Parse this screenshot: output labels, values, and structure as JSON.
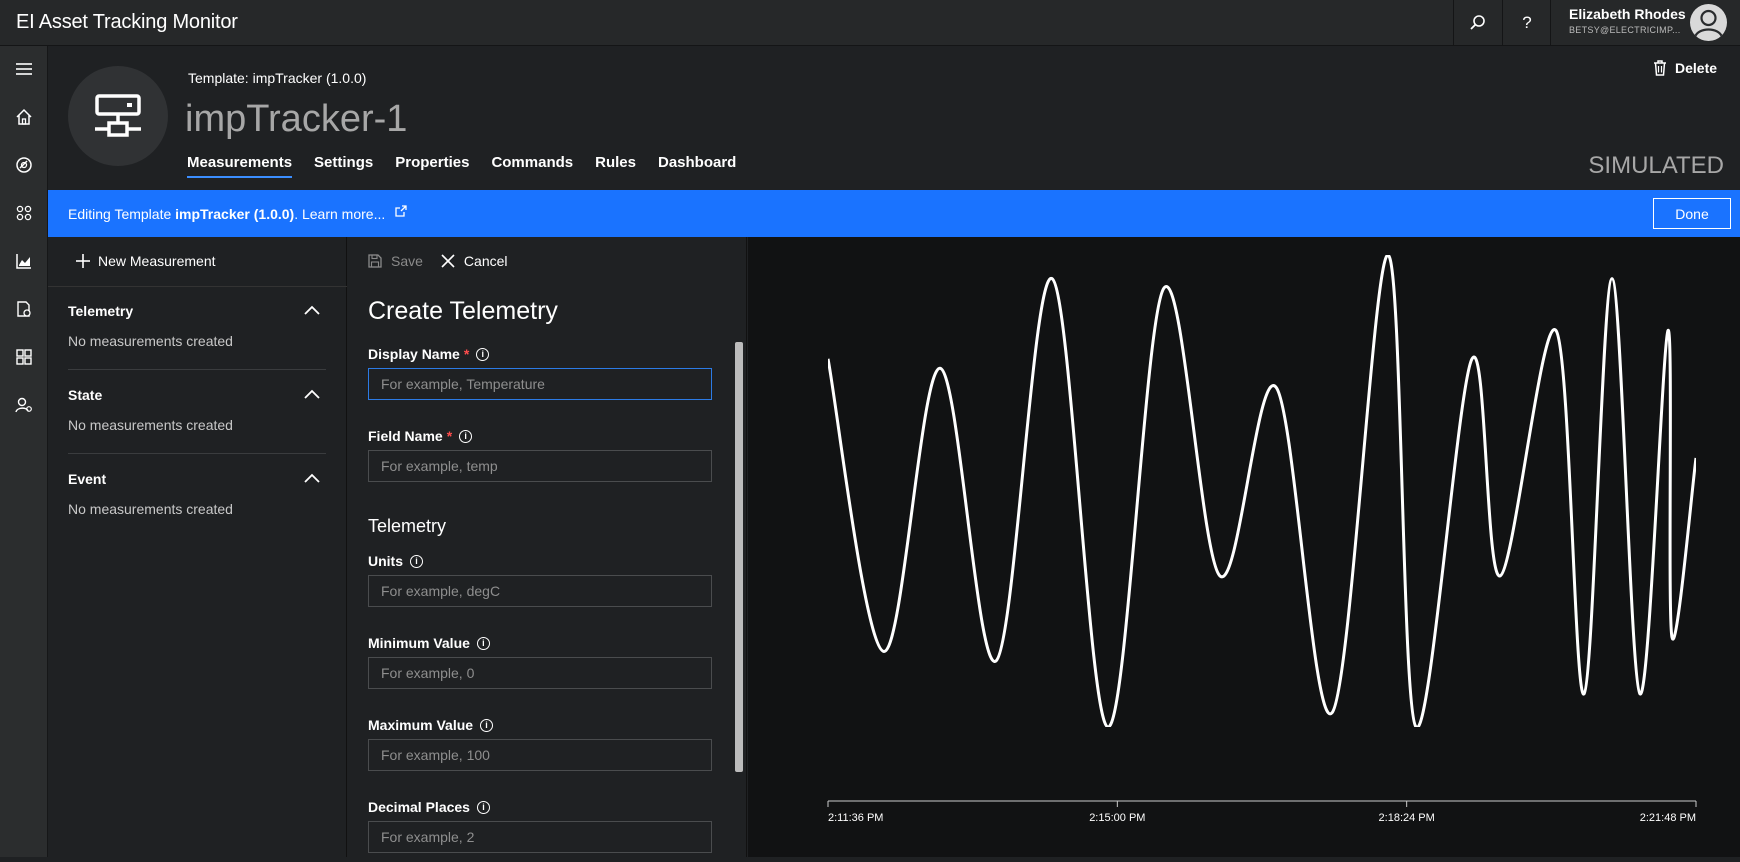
{
  "app": {
    "title": "EI Asset Tracking Monitor"
  },
  "user": {
    "name": "Elizabeth Rhodes",
    "email": "BETSY@ELECTRICIMP..."
  },
  "header": {
    "template_label": "Template:  impTracker  (1.0.0)",
    "device_name": "impTracker-1",
    "delete_label": "Delete",
    "simulated_label": "SIMULATED",
    "tabs": [
      {
        "label": "Measurements",
        "active": true
      },
      {
        "label": "Settings"
      },
      {
        "label": "Properties"
      },
      {
        "label": "Commands"
      },
      {
        "label": "Rules"
      },
      {
        "label": "Dashboard"
      }
    ]
  },
  "banner": {
    "prefix": "Editing Template ",
    "template": "impTracker (1.0.0)",
    "suffix": ". Learn more...",
    "done_label": "Done"
  },
  "measurements": {
    "new_label": "New Measurement",
    "sections": [
      {
        "title": "Telemetry",
        "empty_text": "No measurements created"
      },
      {
        "title": "State",
        "empty_text": "No measurements created"
      },
      {
        "title": "Event",
        "empty_text": "No measurements created"
      }
    ]
  },
  "form": {
    "save_label": "Save",
    "cancel_label": "Cancel",
    "title": "Create Telemetry",
    "section_title": "Telemetry",
    "fields": {
      "display_name": {
        "label": "Display Name",
        "placeholder": "For example, Temperature"
      },
      "field_name": {
        "label": "Field Name",
        "placeholder": "For example, temp"
      },
      "units": {
        "label": "Units",
        "placeholder": "For example, degC"
      },
      "min_value": {
        "label": "Minimum Value",
        "placeholder": "For example, 0"
      },
      "max_value": {
        "label": "Maximum Value",
        "placeholder": "For example, 100"
      },
      "decimal_places": {
        "label": "Decimal Places",
        "placeholder": "For example, 2"
      }
    }
  },
  "chart_data": {
    "type": "line",
    "x_ticks": [
      "2:11:36 PM",
      "2:15:00 PM",
      "2:18:24 PM",
      "2:21:48 PM"
    ],
    "x": [
      "2:11:36 PM",
      "2:11:57 PM",
      "2:12:15 PM",
      "2:12:34 PM",
      "2:12:52 PM",
      "2:13:11 PM",
      "2:13:29 PM",
      "2:13:50 PM",
      "2:14:10 PM",
      "2:14:31 PM",
      "2:14:51 PM",
      "2:15:10 PM",
      "2:15:29 PM",
      "2:15:47 PM",
      "2:16:09 PM",
      "2:16:29 PM",
      "2:16:49 PM",
      "2:17:09 PM",
      "2:17:28 PM",
      "2:17:48 PM",
      "2:18:08 PM",
      "2:18:28 PM",
      "2:18:49 PM",
      "2:19:10 PM",
      "2:19:30 PM",
      "2:19:51 PM",
      "2:20:13 PM",
      "2:20:33 PM",
      "2:20:52 PM",
      "2:21:12 PM",
      "2:21:31 PM",
      "2:21:48 PM"
    ],
    "values": [
      0.78,
      0.16,
      0.76,
      0.14,
      0.95,
      0.0,
      0.93,
      0.32,
      0.72,
      0.03,
      1.0,
      0.0,
      0.78,
      0.32,
      0.84,
      0.07,
      0.95,
      0.07,
      0.84,
      0.19,
      0.57
    ],
    "value_x_index": [
      0,
      2,
      4,
      6,
      8,
      10,
      12,
      14,
      16,
      18,
      20,
      21,
      23,
      24,
      26,
      27,
      28,
      29,
      30,
      30,
      31
    ],
    "ylim": [
      0,
      1
    ],
    "grid": false
  }
}
